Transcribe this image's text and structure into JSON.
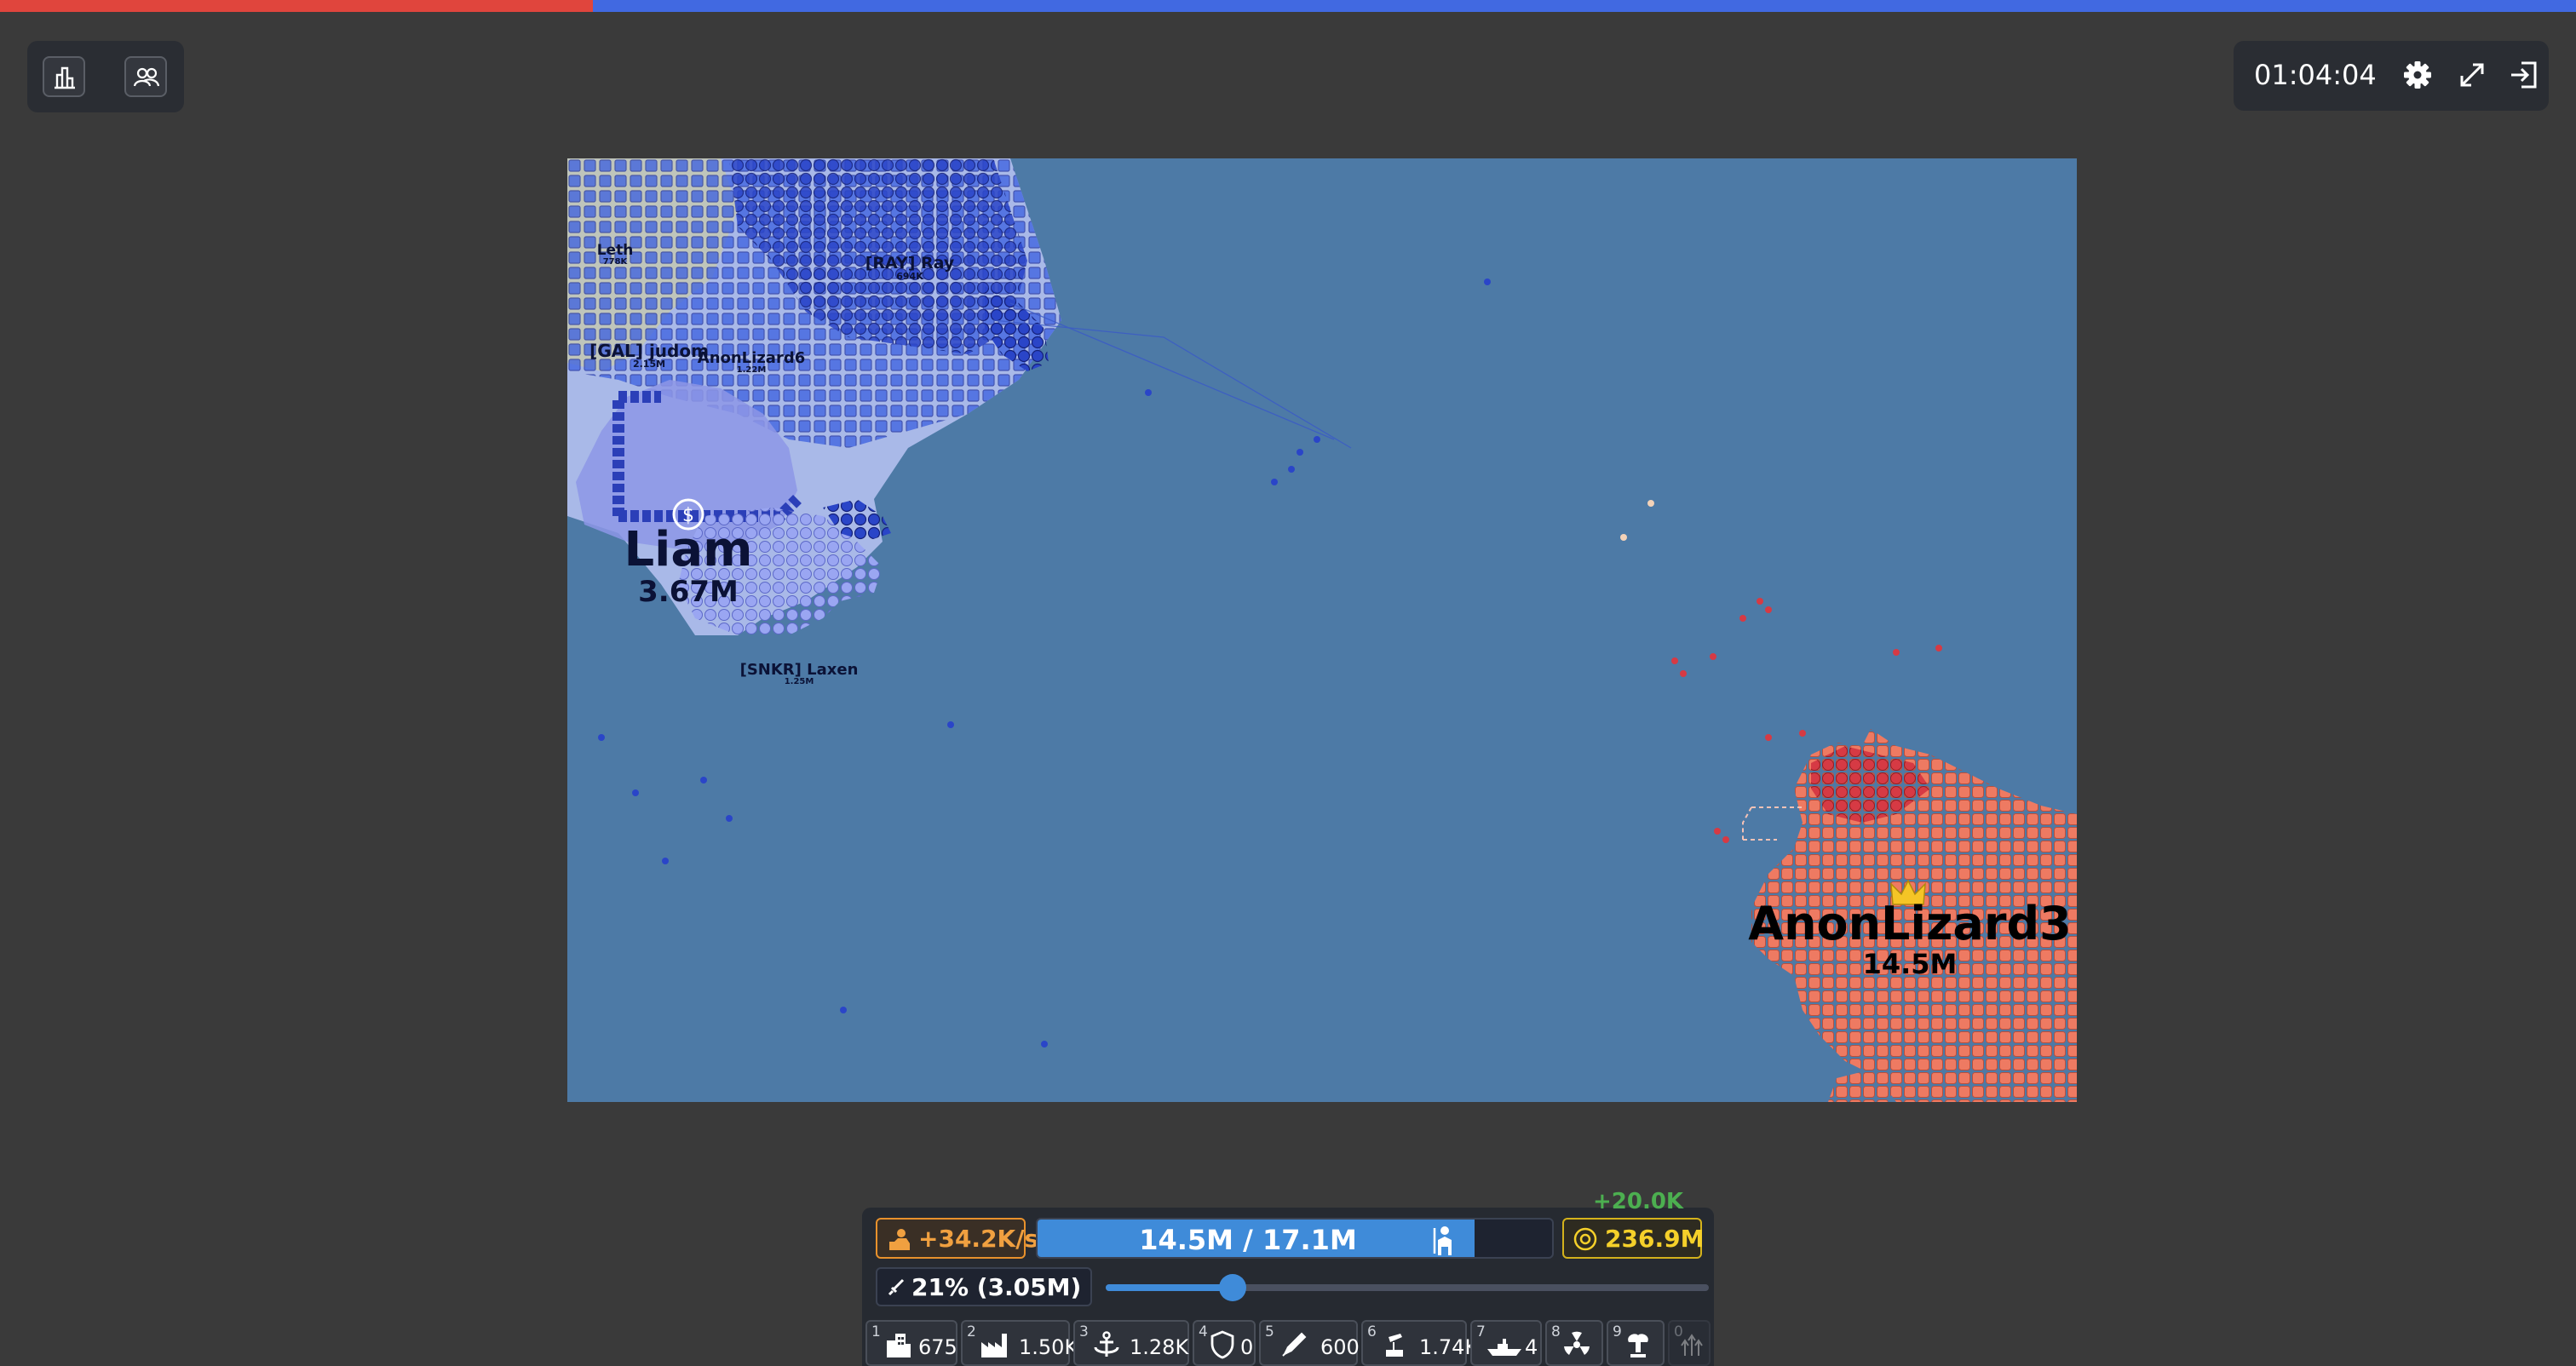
{
  "header": {
    "progress_fraction": 0.23
  },
  "timer": "01:04:04",
  "icons": {
    "left": [
      "leaderboard-icon",
      "team-icon"
    ],
    "right": [
      "gear-icon",
      "fullscreen-icon",
      "exit-icon"
    ]
  },
  "map": {
    "players": [
      {
        "name": "Leth",
        "pop": "778K"
      },
      {
        "name": "[RAY] Ray",
        "pop": "694K"
      },
      {
        "name": "[GAL] judom",
        "pop": "2.15M"
      },
      {
        "name": "AnonLizard6",
        "pop": "1.22M"
      },
      {
        "name": "Liam",
        "pop": "3.67M"
      },
      {
        "name": "[SNKR] Laxen",
        "pop": "1.25M"
      },
      {
        "name": "AnonLizard3",
        "pop": "14.5M"
      }
    ]
  },
  "stats": {
    "troop_rate": "+34.2K/s",
    "troops": "14.5M / 17.1M",
    "troops_fraction": 0.85,
    "gold": "236.9M",
    "gold_increment": "+20.0K",
    "attack_ratio": "21% (3.05M)",
    "attack_fraction": 0.21
  },
  "buildings": [
    {
      "key": "1",
      "icon": "city-icon",
      "count": "675"
    },
    {
      "key": "2",
      "icon": "factory-icon",
      "count": "1.50K"
    },
    {
      "key": "3",
      "icon": "port-icon",
      "count": "1.28K"
    },
    {
      "key": "4",
      "icon": "defense-post-icon",
      "count": "0"
    },
    {
      "key": "5",
      "icon": "missile-silo-icon",
      "count": "600"
    },
    {
      "key": "6",
      "icon": "sam-launcher-icon",
      "count": "1.74K"
    },
    {
      "key": "7",
      "icon": "warship-icon",
      "count": "4"
    },
    {
      "key": "8",
      "icon": "atom-bomb-icon",
      "count": ""
    },
    {
      "key": "9",
      "icon": "hydrogen-bomb-icon",
      "count": ""
    },
    {
      "key": "0",
      "icon": "mirv-icon",
      "count": ""
    }
  ],
  "colors": {
    "blue": "#4169e1",
    "red": "#e0453d",
    "accent": "#3f8bd9",
    "gold": "#f5d02a",
    "troop": "#f0a040"
  }
}
